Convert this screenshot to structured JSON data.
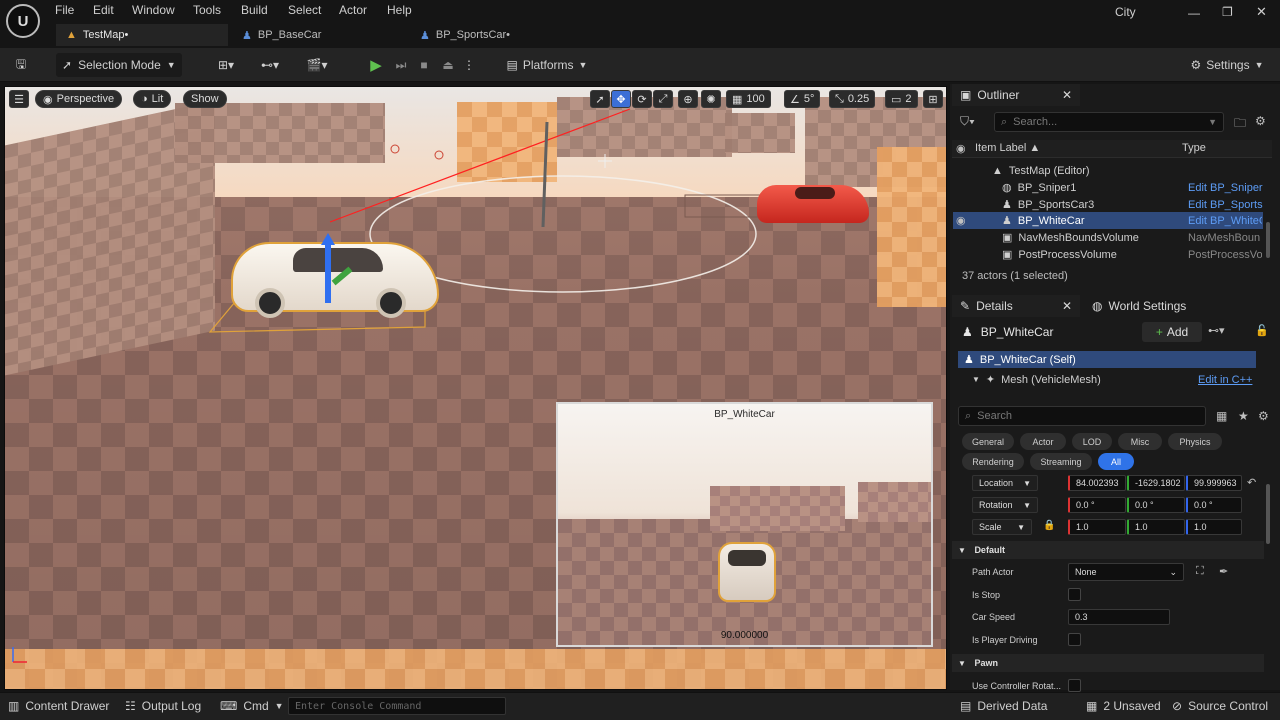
{
  "app": {
    "logo_icon": "unreal-logo-icon",
    "project": "City"
  },
  "menu": [
    "File",
    "Edit",
    "Window",
    "Tools",
    "Build",
    "Select",
    "Actor",
    "Help"
  ],
  "tabs": [
    {
      "label": "TestMap•",
      "active": true
    },
    {
      "label": "BP_BaseCar",
      "active": false
    },
    {
      "label": "BP_SportsCar•",
      "active": false
    }
  ],
  "toolbar": {
    "selection_mode": "Selection Mode",
    "platforms": "Platforms",
    "settings": "Settings"
  },
  "viewport": {
    "perspective": "Perspective",
    "lit": "Lit",
    "show": "Show",
    "grid_size": "100",
    "rotation_snap": "5°",
    "scale_snap": "0.25",
    "camera_speed": "2",
    "pip_title": "BP_WhiteCar",
    "pip_readout": "90.000000"
  },
  "outliner": {
    "title": "Outliner",
    "search_placeholder": "Search...",
    "col_label": "Item Label ▲",
    "col_type": "Type",
    "root": "TestMap (Editor)",
    "rows": [
      {
        "label": "BP_Sniper1",
        "type": "Edit BP_Sniper",
        "link": true,
        "selected": false
      },
      {
        "label": "BP_SportsCar3",
        "type": "Edit BP_Sports",
        "link": true,
        "selected": false
      },
      {
        "label": "BP_WhiteCar",
        "type": "Edit BP_WhiteC",
        "link": true,
        "selected": true
      },
      {
        "label": "NavMeshBoundsVolume",
        "type": "NavMeshBoun",
        "link": false,
        "selected": false
      },
      {
        "label": "PostProcessVolume",
        "type": "PostProcessVo",
        "link": false,
        "selected": false
      }
    ],
    "status": "37 actors (1 selected)"
  },
  "details": {
    "tab": "Details",
    "world_tab": "World Settings",
    "actor_name": "BP_WhiteCar",
    "add_label": "Add",
    "self_row": "BP_WhiteCar (Self)",
    "mesh_row": "Mesh (VehicleMesh)",
    "mesh_edit": "Edit in C++",
    "search_placeholder": "Search",
    "categories": [
      "General",
      "Actor",
      "LOD",
      "Misc",
      "Physics",
      "Rendering",
      "Streaming",
      "All"
    ],
    "location_label": "Location",
    "location": [
      "84.002393",
      "-1629.1802",
      "99.999963"
    ],
    "rotation_label": "Rotation",
    "rotation": [
      "0.0 °",
      "0.0 °",
      "0.0 °"
    ],
    "scale_label": "Scale",
    "scale": [
      "1.0",
      "1.0",
      "1.0"
    ],
    "default_section": "Default",
    "path_actor_label": "Path Actor",
    "path_actor_value": "None",
    "is_stop_label": "Is Stop",
    "car_speed_label": "Car Speed",
    "car_speed_value": "0.3",
    "is_player_driving_label": "Is Player Driving",
    "pawn_section": "Pawn",
    "use_controller_label": "Use Controller Rotat..."
  },
  "statusbar": {
    "content_drawer": "Content Drawer",
    "output_log": "Output Log",
    "cmd": "Cmd",
    "console_placeholder": "Enter Console Command",
    "derived_data": "Derived Data",
    "unsaved": "2 Unsaved",
    "source_control": "Source Control"
  },
  "colors": {
    "accent": "#2f73e8",
    "selection_outline": "#e0a23a",
    "link": "#5d9cf5"
  }
}
